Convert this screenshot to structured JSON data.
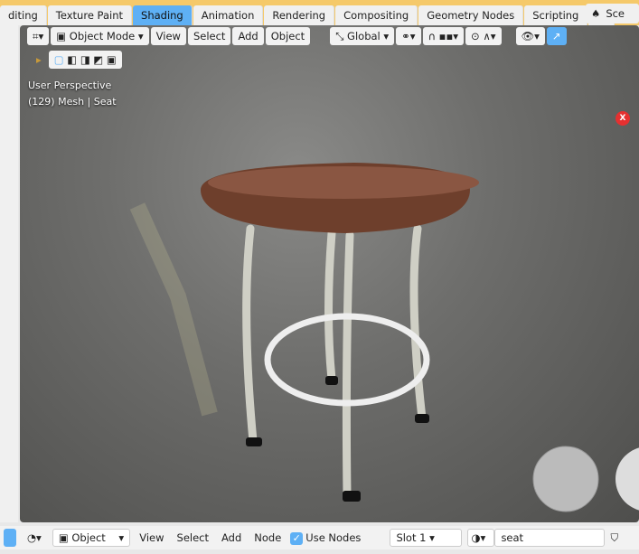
{
  "workspace_tabs": [
    "diting",
    "Texture Paint",
    "Shading",
    "Animation",
    "Rendering",
    "Compositing",
    "Geometry Nodes",
    "Scripting",
    "+"
  ],
  "active_tab": "Shading",
  "scene_label": "Sce",
  "viewport_header": {
    "mode": "Object Mode",
    "menus": [
      "View",
      "Select",
      "Add",
      "Object"
    ],
    "transform": "Global"
  },
  "overlay": {
    "perspective": "User Perspective",
    "object_info": "(129) Mesh | Seat"
  },
  "gizmo_x": "X",
  "node_header": {
    "type": "Object",
    "menus": [
      "View",
      "Select",
      "Add",
      "Node"
    ],
    "use_nodes_label": "Use Nodes",
    "use_nodes_checked": true,
    "slot": "Slot 1",
    "material": "seat"
  },
  "colors": {
    "accent": "#5eb0f5",
    "topbar": "#f5c96a"
  }
}
